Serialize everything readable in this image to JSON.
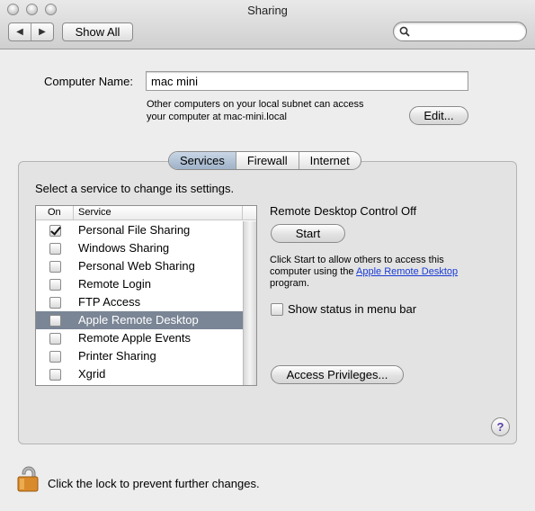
{
  "window": {
    "title": "Sharing",
    "show_all_label": "Show All",
    "back_icon": "back-arrow-icon",
    "forward_icon": "forward-arrow-icon",
    "search_placeholder": ""
  },
  "computer_name": {
    "label": "Computer Name:",
    "value": "mac mini",
    "description_line1": "Other computers on your local subnet can access",
    "description_line2": "your computer at mac-mini.local",
    "edit_label": "Edit..."
  },
  "tabs": [
    {
      "label": "Services",
      "active": true
    },
    {
      "label": "Firewall",
      "active": false
    },
    {
      "label": "Internet",
      "active": false
    }
  ],
  "services": {
    "instruction": "Select a service to change its settings.",
    "column_on": "On",
    "column_service": "Service",
    "items": [
      {
        "name": "Personal File Sharing",
        "on": true,
        "selected": false
      },
      {
        "name": "Windows Sharing",
        "on": false,
        "selected": false
      },
      {
        "name": "Personal Web Sharing",
        "on": false,
        "selected": false
      },
      {
        "name": "Remote Login",
        "on": false,
        "selected": false
      },
      {
        "name": "FTP Access",
        "on": false,
        "selected": false
      },
      {
        "name": "Apple Remote Desktop",
        "on": false,
        "selected": true
      },
      {
        "name": "Remote Apple Events",
        "on": false,
        "selected": false
      },
      {
        "name": "Printer Sharing",
        "on": false,
        "selected": false
      },
      {
        "name": "Xgrid",
        "on": false,
        "selected": false
      }
    ]
  },
  "details": {
    "status": "Remote Desktop Control Off",
    "start_label": "Start",
    "desc_line1": "Click Start to allow others to access this",
    "desc_line2_prefix": "computer using the ",
    "desc_link": "Apple Remote Desktop",
    "desc_line3": "program.",
    "show_status_label": "Show status in menu bar",
    "show_status_checked": false,
    "access_privileges_label": "Access Privileges...",
    "help_label": "?"
  },
  "lock": {
    "text": "Click the lock to prevent further changes.",
    "icon": "lock-icon"
  },
  "colors": {
    "selection": "#7a8595",
    "link": "#1a3bd6",
    "active_tab": "#9fb2c8"
  }
}
